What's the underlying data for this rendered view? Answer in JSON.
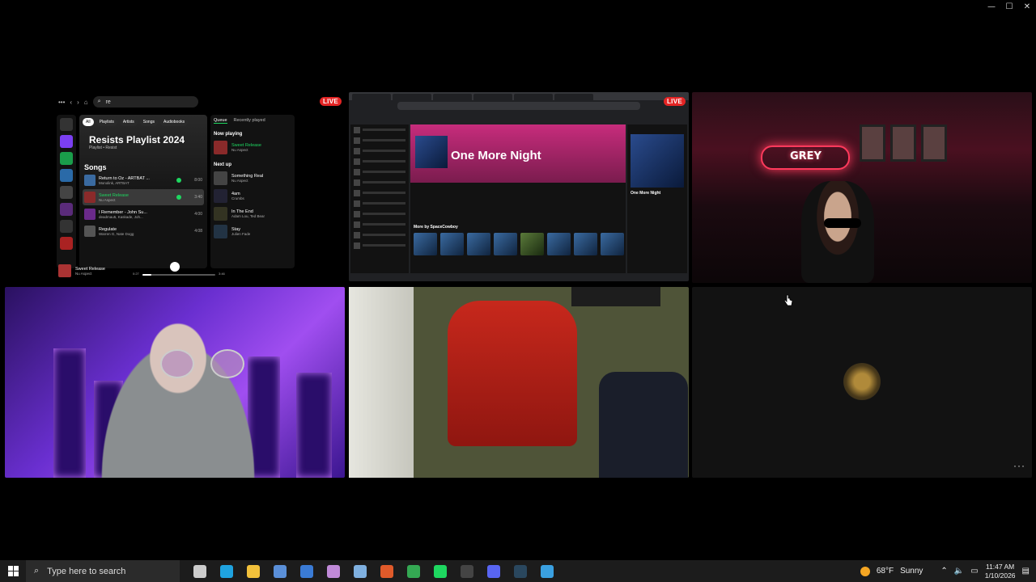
{
  "window": {
    "minimize": "—",
    "maximize": "☐",
    "close": "✕"
  },
  "live_badge": "LIVE",
  "spotify": {
    "search_value": "re",
    "chips": [
      "All",
      "Playlists",
      "Artists",
      "Songs",
      "Audiobooks"
    ],
    "playlist_title": "Resists Playlist 2024",
    "playlist_sub": "Playlist • Resist",
    "songs_heading": "Songs",
    "songs": [
      {
        "name": "Return to Oz - ARTBAT ...",
        "artist": "Monolink, ARTBAT",
        "duration": "8:00"
      },
      {
        "name": "Sweet Release",
        "artist": "Nu Aspect",
        "duration": "3:40"
      },
      {
        "name": "I Remember - John Su...",
        "artist": "deadmau5, Kaskade, Joh...",
        "duration": "4:00"
      },
      {
        "name": "Regulate",
        "artist": "Warren G, Nate Dogg",
        "duration": "4:08"
      }
    ],
    "queue_tabs": [
      "Queue",
      "Recently played"
    ],
    "now_playing_label": "Now playing",
    "now_playing": {
      "name": "Sweet Release",
      "artist": "Nu Aspect"
    },
    "next_up_label": "Next up",
    "next_up": [
      {
        "name": "Something Real",
        "artist": "Nu Aspect"
      },
      {
        "name": "4am",
        "artist": "Crumbs"
      },
      {
        "name": "In The End",
        "artist": "Adam Lou, Ted Bear"
      },
      {
        "name": "Stay",
        "artist": "Julien Fade"
      }
    ],
    "player": {
      "name": "Sweet Release",
      "artist": "Nu Aspect",
      "elapsed": "0:27",
      "total": "3:46",
      "progress": 0.12
    }
  },
  "browser": {
    "track_title": "One More Night",
    "more_by": "More by SpaceCowboy",
    "side_title": "One More Night"
  },
  "webcam": {
    "neon_sign": "GREY"
  },
  "cursor_icon": "hand-pointer-icon",
  "overflow_menu": "···",
  "taskbar": {
    "search_placeholder": "Type here to search",
    "weather_temp": "68°F",
    "weather_desc": "Sunny",
    "time": "11:47 AM",
    "date": "1/10/2026",
    "apps": [
      {
        "icon": "task-view-icon",
        "color": "#cccccc"
      },
      {
        "icon": "edge-icon",
        "color": "#1fa3e0"
      },
      {
        "icon": "file-explorer-icon",
        "color": "#f2c13b"
      },
      {
        "icon": "remote-desktop-icon",
        "color": "#5a8fd8"
      },
      {
        "icon": "calculator-icon",
        "color": "#3a7bd5"
      },
      {
        "icon": "app-icon",
        "color": "#c08ad8"
      },
      {
        "icon": "notepad-icon",
        "color": "#7fb0e0"
      },
      {
        "icon": "brave-icon",
        "color": "#e05a2a"
      },
      {
        "icon": "chrome-icon",
        "color": "#34a853"
      },
      {
        "icon": "spotify-icon",
        "color": "#1ed760"
      },
      {
        "icon": "obs-icon",
        "color": "#444444"
      },
      {
        "icon": "discord-icon",
        "color": "#5865f2"
      },
      {
        "icon": "steam-icon",
        "color": "#2a475e"
      },
      {
        "icon": "paint-icon",
        "color": "#3aa0e0"
      }
    ]
  }
}
